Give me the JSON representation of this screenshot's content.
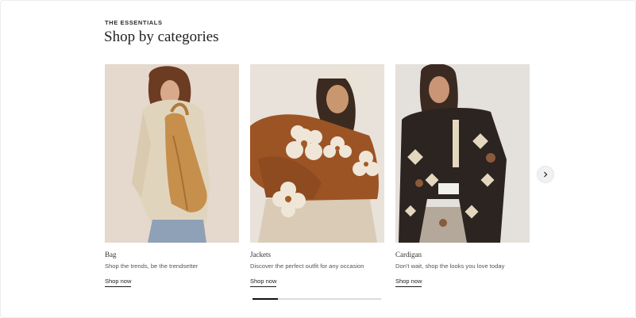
{
  "section": {
    "eyebrow": "THE ESSENTIALS",
    "title": "Shop by categories"
  },
  "cards": [
    {
      "title": "Bag",
      "description": "Shop the trends, be the trendsetter",
      "cta": "Shop now",
      "image_alt": "Model wearing a cream cable-knit sweater with a tan leather backpack"
    },
    {
      "title": "Jackets",
      "description": "Discover the perfect outfit for any occasion",
      "cta": "Shop now",
      "image_alt": "Model in a brown fleece jacket with white flower appliques and a knit bucket hat"
    },
    {
      "title": "Cardigan",
      "description": "Don't wait, shop the looks you love today",
      "cta": "Shop now",
      "image_alt": "Model in a black and cream patterned knit cardigan"
    }
  ],
  "carousel": {
    "next_icon": "chevron-right-icon",
    "progress_fraction": 0.2
  },
  "colors": {
    "text": "#1c1c1c",
    "muted": "#555555",
    "track": "#dcdcdc",
    "thumb": "#111111"
  }
}
